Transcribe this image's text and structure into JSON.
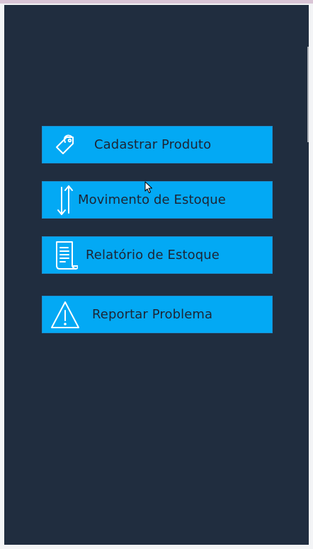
{
  "menu": {
    "items": [
      {
        "label": "Cadastrar Produto",
        "icon": "tag-icon"
      },
      {
        "label": "Movimento de Estoque",
        "icon": "arrows-up-down-icon"
      },
      {
        "label": "Relatório de Estoque",
        "icon": "document-icon"
      },
      {
        "label": "Reportar Problema",
        "icon": "warning-icon"
      }
    ]
  },
  "colors": {
    "background": "#202d3f",
    "button": "#03a9f4",
    "button_text": "#1d2535",
    "icon": "#ffffff"
  }
}
